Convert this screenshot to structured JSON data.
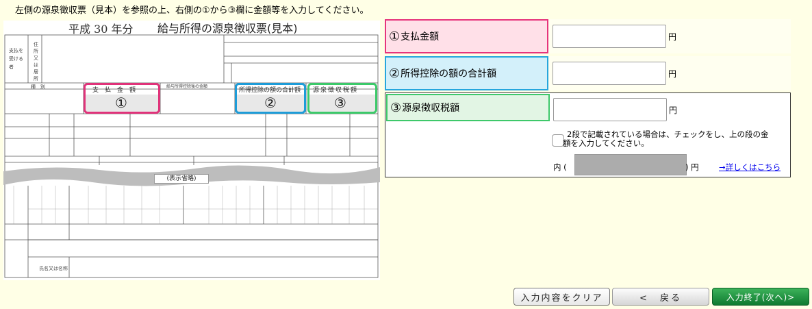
{
  "instruction": "左側の源泉徴収票（見本）を参照の上、右側の①から③欄に金額等を入力してください。",
  "sample": {
    "era": "平成 30 年分",
    "title": "給与所得の源泉徴収票(見本)",
    "col_payment": "支　払　金　額",
    "col_deduction_total": "所得控除の額の合計額",
    "col_withholding": "源泉徴収税額",
    "num1": "①",
    "num2": "②",
    "num3": "③",
    "omitted": "(表示省略)",
    "payer_label": "支払を受ける者",
    "address_label": "住所又は居所",
    "name_label": "氏名又は名称",
    "category_label": "種　別",
    "salary_label": "給与所得控除後の金額"
  },
  "form": {
    "row1": {
      "num": "①",
      "label": "支払金額",
      "value": "",
      "unit": "円"
    },
    "row2": {
      "num": "②",
      "label": "所得控除の額の合計額",
      "value": "",
      "unit": "円"
    },
    "row3": {
      "num": "③",
      "label": "源泉徴収税額",
      "value": "",
      "unit": "円",
      "checkbox_text_1": "2段で記載されている場合は、チェックをし、上の段の金",
      "checkbox_text_2": "額を入力してください。",
      "uchi_prefix": "内 (",
      "uchi_suffix": ") 円",
      "detail_link": "→詳しくはこちら"
    }
  },
  "buttons": {
    "clear": "入力内容をクリア",
    "back": "<　戻る",
    "next": "入力終了(次へ)>"
  },
  "colors": {
    "pink": "#E6347C",
    "blue": "#26A6DD",
    "green": "#3EC86A",
    "page_bg": "#FFFFE6"
  }
}
